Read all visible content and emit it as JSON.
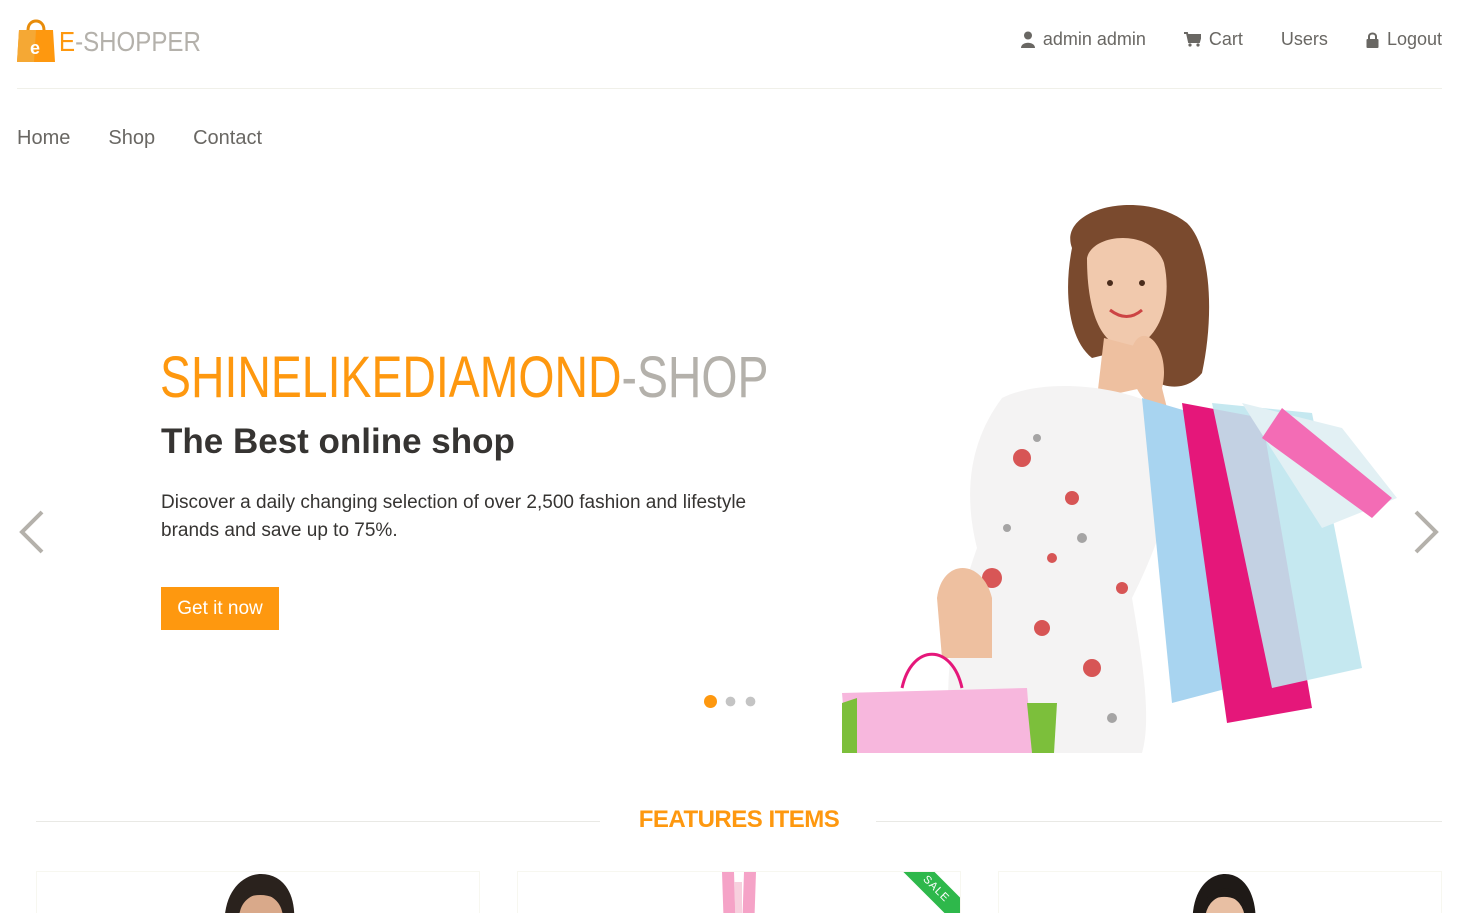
{
  "brand": {
    "first": "e",
    "rest": "E-SHOPPER",
    "bag_letter": "e"
  },
  "topnav": {
    "account": "admin admin",
    "cart": "Cart",
    "users": "Users",
    "logout": "Logout"
  },
  "mainnav": {
    "home": "Home",
    "shop": "Shop",
    "contact": "Contact"
  },
  "slider": {
    "title_part1": "SHINELIKEDIAMOND",
    "title_part2": "-SHOP",
    "subtitle": "The Best online shop",
    "description": "Discover a daily changing selection of over 2,500 fashion and lifestyle brands and save up to 75%.",
    "button": "Get it now",
    "slides_count": 3,
    "active_slide": 1
  },
  "features": {
    "title": "FEATURES ITEMS",
    "sale_badge": "SALE"
  },
  "colors": {
    "accent": "#fe980f",
    "muted": "#b4b1ab",
    "text": "#696763",
    "dark": "#363432",
    "sale": "#2eb84b"
  }
}
